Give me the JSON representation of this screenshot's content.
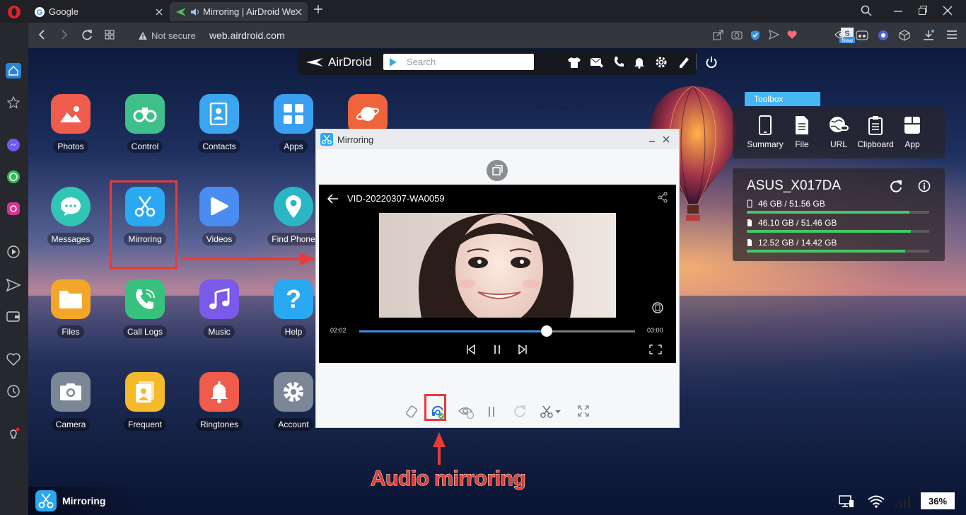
{
  "browser": {
    "tabs": [
      {
        "title": "Google",
        "icon": "google-icon"
      },
      {
        "title": "Mirroring | AirDroid We",
        "icon": "airdroid-icon",
        "audio": "speaker-icon"
      }
    ],
    "address": {
      "security": "Not secure",
      "url": "web.airdroid.com"
    },
    "new_badge": "New"
  },
  "airdroid": {
    "logo": "AirDroid",
    "search_placeholder": "Search",
    "toolbar_icons": [
      "shirt-icon",
      "sms-icon",
      "phone-icon",
      "bell-icon",
      "gear-icon",
      "edit-icon",
      "power-icon"
    ],
    "apps": [
      {
        "label": "Photos",
        "color": "#ef5c4c",
        "icon": "photos-icon"
      },
      {
        "label": "Control",
        "color": "#3fc08a",
        "icon": "binoculars-icon"
      },
      {
        "label": "Contacts",
        "color": "#3aa6f0",
        "icon": "contacts-icon"
      },
      {
        "label": "Apps",
        "color": "#3a9ff1",
        "icon": "apps-grid-icon"
      },
      {
        "label": "",
        "color": "#f0643c",
        "icon": "planet-icon"
      },
      {
        "label": "Messages",
        "color": "#31c5b4",
        "icon": "chat-icon"
      },
      {
        "label": "Mirroring",
        "color": "#2aa8f2",
        "icon": "scissors-icon"
      },
      {
        "label": "Videos",
        "color": "#4a8cf0",
        "icon": "play-icon"
      },
      {
        "label": "Find Phone",
        "color": "#2bb6c6",
        "icon": "location-pin-icon"
      },
      {
        "label": "Files",
        "color": "#f2a62a",
        "icon": "folder-icon"
      },
      {
        "label": "Call Logs",
        "color": "#36c27d",
        "icon": "phone-call-icon"
      },
      {
        "label": "Music",
        "color": "#7a5ae8",
        "icon": "music-note-icon"
      },
      {
        "label": "Help",
        "color": "#2aa8f2",
        "icon": "question-icon"
      },
      {
        "label": "Camera",
        "color": "#7b8796",
        "icon": "camera-icon"
      },
      {
        "label": "Frequent",
        "color": "#f5b92c",
        "icon": "frequent-icon"
      },
      {
        "label": "Ringtones",
        "color": "#ef5c4c",
        "icon": "bell-icon"
      },
      {
        "label": "Account",
        "color": "#7b8796",
        "icon": "gear-icon"
      }
    ],
    "toolbox": {
      "title": "Toolbox",
      "items": [
        "Summary",
        "File",
        "URL",
        "Clipboard",
        "App"
      ]
    },
    "device": {
      "name": "ASUS_X017DA",
      "storage": [
        {
          "label": "46 GB / 51.56 GB",
          "fraction": 0.89
        },
        {
          "label": "46.10 GB / 51.46 GB",
          "fraction": 0.9
        },
        {
          "label": "12.52 GB / 14.42 GB",
          "fraction": 0.87
        }
      ]
    },
    "mirroring_window": {
      "title": "Mirroring",
      "video_title": "VID-20220307-WA0059",
      "time_elapsed": "02:02",
      "time_total": "03:00",
      "progress": 0.68,
      "controls": [
        "rotate-icon",
        "audio-mirroring-icon",
        "hd-eye-icon",
        "pause-icon",
        "refresh-icon",
        "scissors-icon",
        "fullscreen-icon"
      ]
    },
    "annotation": "Audio mirroring",
    "taskbar": {
      "item": "Mirroring",
      "battery": "36%"
    }
  }
}
